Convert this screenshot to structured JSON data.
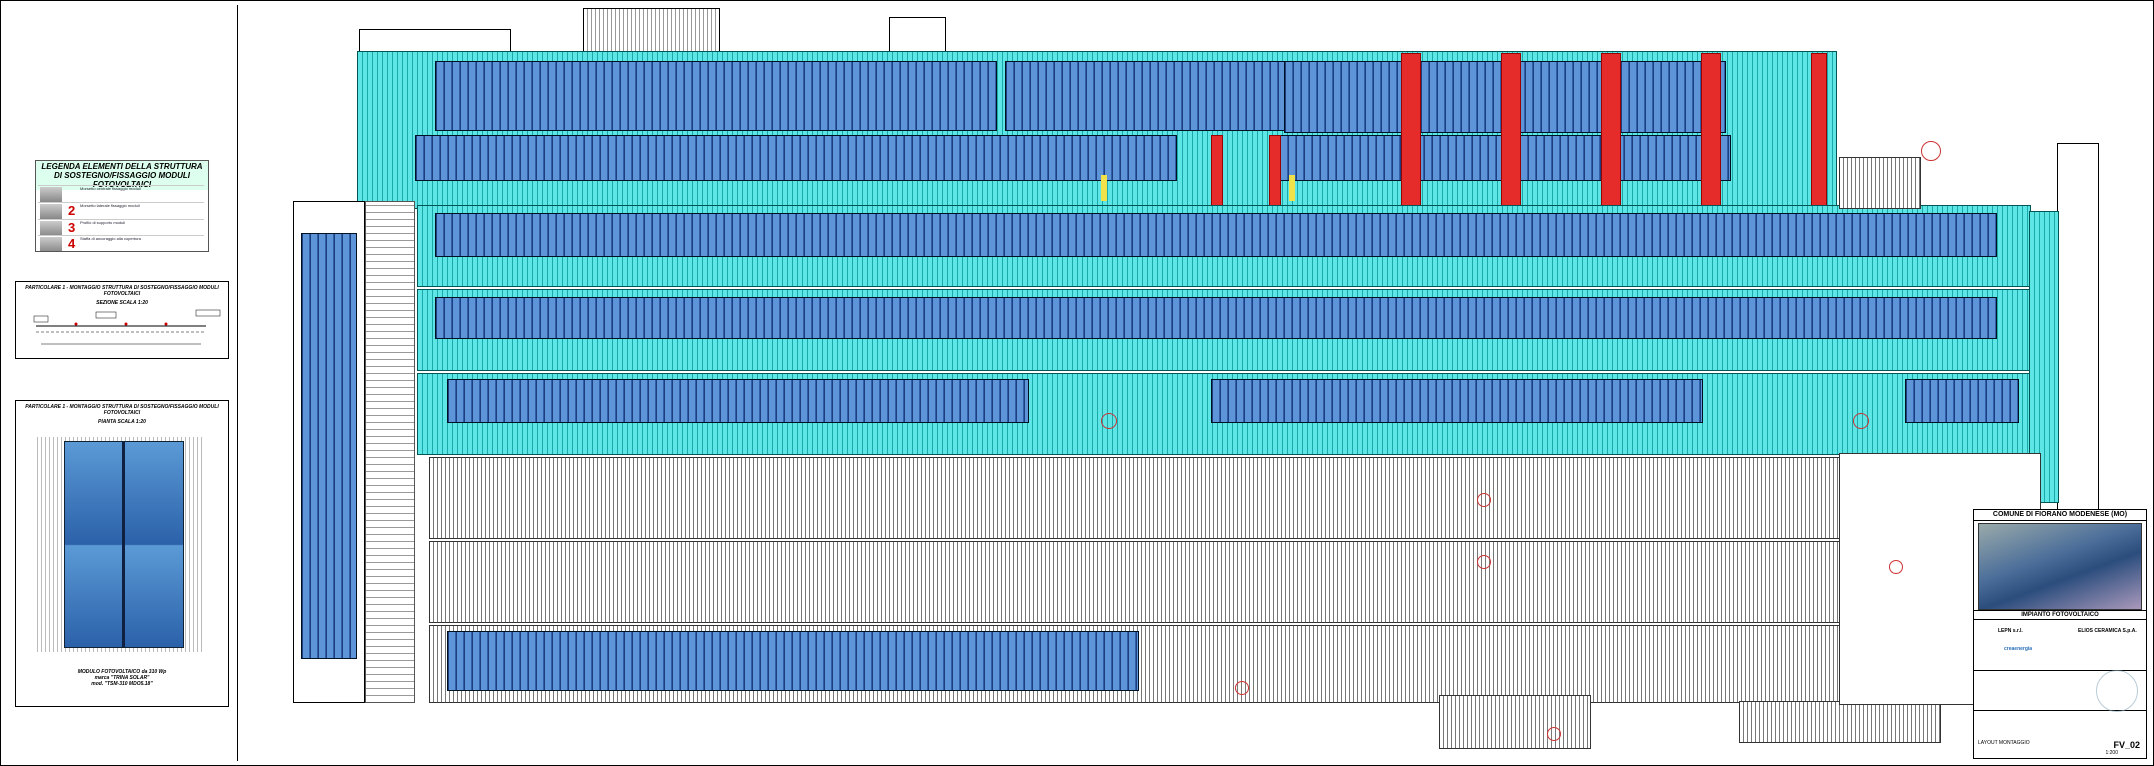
{
  "legend": {
    "title": "LEGENDA ELEMENTI DELLA STRUTTURA DI SOSTEGNO/FISSAGGIO MODULI FOTOVOLTAICI",
    "items": [
      {
        "num": "",
        "text": "Morsetto centrale fissaggio moduli"
      },
      {
        "num": "2",
        "text": "Morsetto laterale fissaggio moduli"
      },
      {
        "num": "3",
        "text": "Profilo di supporto moduli"
      },
      {
        "num": "4",
        "text": "Staffa di ancoraggio alla copertura"
      }
    ]
  },
  "detail_a": {
    "title": "PARTICOLARE 1 - MONTAGGIO STRUTTURA DI SOSTEGNO/FISSAGGIO MODULI FOTOVOLTAICI",
    "subtitle": "SEZIONE SCALA 1:20"
  },
  "detail_b": {
    "title": "PARTICOLARE 1 - MONTAGGIO STRUTTURA DI SOSTEGNO/FISSAGGIO MODULI FOTOVOLTAICI",
    "subtitle": "PIANTA SCALA 1:20",
    "caption1": "MODULO FOTOVOLTAICO da 310 Wp",
    "caption2": "marca \"TRINA SOLAR\"",
    "caption3": "mod. \"TSM-310 MDO5.18\""
  },
  "title_block": {
    "municipality": "COMUNE DI FIORANO MODENESE (MO)",
    "project": "IMPIANTO FOTOVOLTAICO",
    "designer": "LEPN s.r.l.",
    "client": "ELIOS CERAMICA S.p.A.",
    "brand": "creaenergia",
    "drawing_title": "LAYOUT MONTAGGIO",
    "scale": "1:200",
    "code": "FV_02"
  },
  "colors": {
    "module_blue": "#3a6fb8",
    "roof_cyan": "#4fe0e0",
    "structure_red": "#e62b2b",
    "highlight_yellow": "#f2e24a"
  }
}
